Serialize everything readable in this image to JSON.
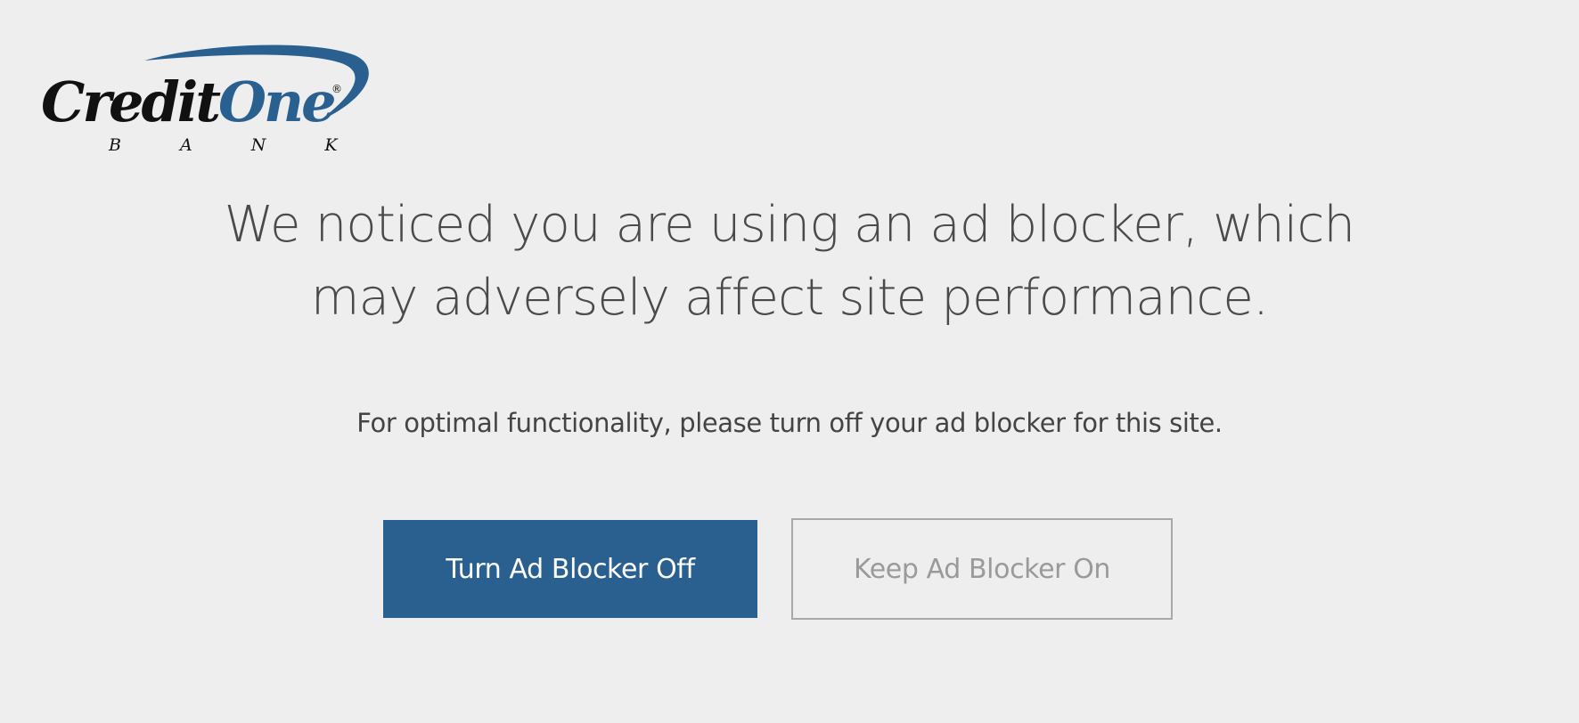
{
  "logo": {
    "name_part1": "Credit",
    "name_part2": "One",
    "registered": "®",
    "subtitle": "B A N K",
    "colors": {
      "dark": "#111111",
      "blue": "#2a6090"
    }
  },
  "headline": "We noticed you are using an ad blocker, which may adversely affect site performance.",
  "subtext": "For optimal functionality, please turn off your ad blocker for this site.",
  "buttons": {
    "primary_label": "Turn Ad Blocker Off",
    "secondary_label": "Keep Ad Blocker On"
  },
  "colors": {
    "background": "#eeeeee",
    "primary_button": "#2a6090",
    "text": "#444444",
    "secondary_text": "#9a9a9a"
  }
}
